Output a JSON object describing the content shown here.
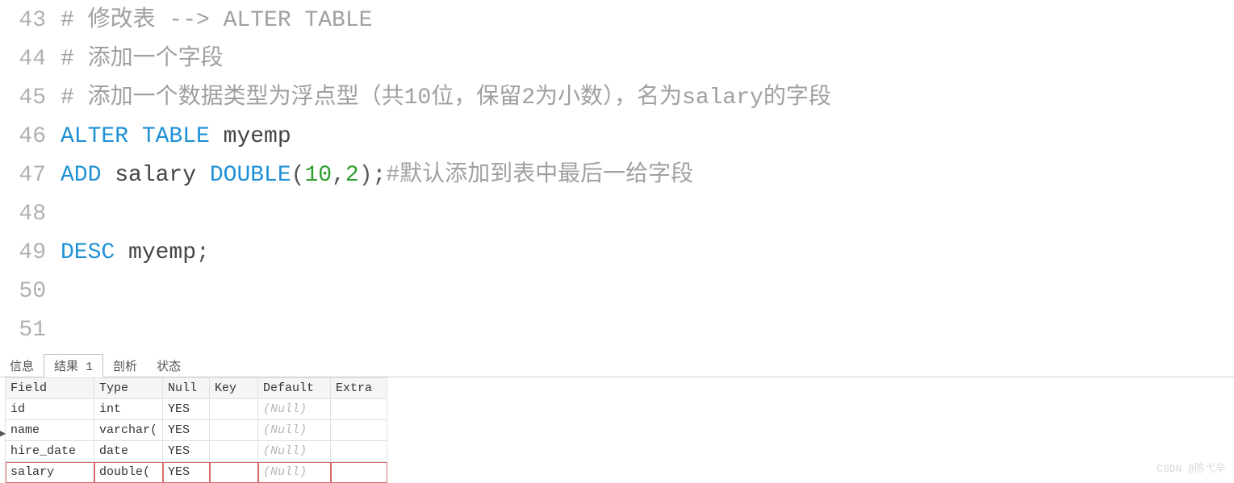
{
  "code": {
    "lines": [
      {
        "num": "43",
        "tokens": [
          {
            "cls": "tok-comment",
            "t": "# 修改表 --> ALTER TABLE"
          }
        ]
      },
      {
        "num": "44",
        "tokens": [
          {
            "cls": "tok-comment",
            "t": "# 添加一个字段"
          }
        ]
      },
      {
        "num": "45",
        "tokens": [
          {
            "cls": "tok-comment",
            "t": "# 添加一个数据类型为浮点型（共10位，保留2为小数），名为salary的字段"
          }
        ]
      },
      {
        "num": "46",
        "tokens": [
          {
            "cls": "tok-keyword",
            "t": "ALTER"
          },
          {
            "cls": "tok-plain",
            "t": " "
          },
          {
            "cls": "tok-keyword",
            "t": "TABLE"
          },
          {
            "cls": "tok-plain",
            "t": " myemp"
          }
        ]
      },
      {
        "num": "47",
        "tokens": [
          {
            "cls": "tok-keyword",
            "t": "ADD"
          },
          {
            "cls": "tok-plain",
            "t": " salary "
          },
          {
            "cls": "tok-keyword",
            "t": "DOUBLE"
          },
          {
            "cls": "tok-punc",
            "t": "("
          },
          {
            "cls": "tok-number",
            "t": "10"
          },
          {
            "cls": "tok-punc",
            "t": ","
          },
          {
            "cls": "tok-number",
            "t": "2"
          },
          {
            "cls": "tok-punc",
            "t": ");"
          },
          {
            "cls": "tok-comment",
            "t": "#默认添加到表中最后一给字段"
          }
        ]
      },
      {
        "num": "48",
        "tokens": []
      },
      {
        "num": "49",
        "tokens": [
          {
            "cls": "tok-keyword",
            "t": "DESC"
          },
          {
            "cls": "tok-plain",
            "t": " myemp"
          },
          {
            "cls": "tok-punc",
            "t": ";"
          }
        ]
      },
      {
        "num": "50",
        "tokens": []
      },
      {
        "num": "51",
        "tokens": []
      }
    ]
  },
  "tabs": {
    "items": [
      {
        "label": "信息",
        "active": false
      },
      {
        "label": "结果 1",
        "active": true
      },
      {
        "label": "剖析",
        "active": false
      },
      {
        "label": "状态",
        "active": false
      }
    ]
  },
  "result": {
    "columns": [
      "Field",
      "Type",
      "Null",
      "Key",
      "Default",
      "Extra"
    ],
    "pointer_row": 1,
    "highlight_row": 3,
    "rows": [
      {
        "Field": "id",
        "Type": "int",
        "Null": "YES",
        "Key": "",
        "Default": "(Null)",
        "Extra": ""
      },
      {
        "Field": "name",
        "Type": "varchar(",
        "Null": "YES",
        "Key": "",
        "Default": "(Null)",
        "Extra": ""
      },
      {
        "Field": "hire_date",
        "Type": "date",
        "Null": "YES",
        "Key": "",
        "Default": "(Null)",
        "Extra": ""
      },
      {
        "Field": "salary",
        "Type": "double(",
        "Null": "YES",
        "Key": "",
        "Default": "(Null)",
        "Extra": ""
      }
    ]
  },
  "watermark": "CSDN @陈弋辛"
}
